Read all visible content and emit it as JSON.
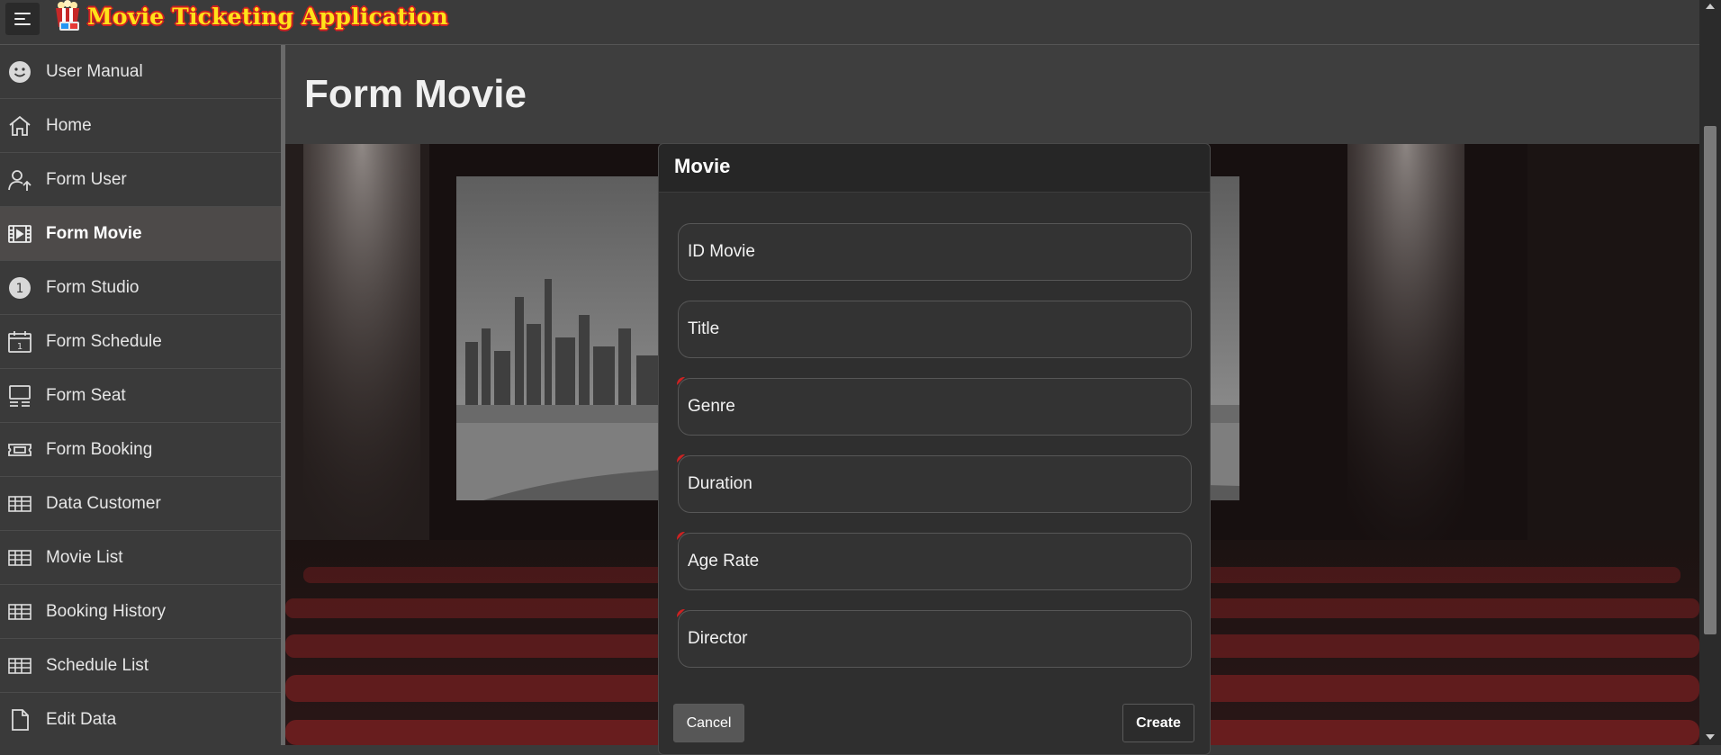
{
  "app": {
    "title": "Movie Ticketing Application"
  },
  "sidebar": {
    "items": [
      {
        "label": "User Manual",
        "icon": "smiley-icon",
        "active": false
      },
      {
        "label": "Home",
        "icon": "home-icon",
        "active": false
      },
      {
        "label": "Form User",
        "icon": "user-upload-icon",
        "active": false
      },
      {
        "label": "Form Movie",
        "icon": "film-icon",
        "active": true
      },
      {
        "label": "Form Studio",
        "icon": "number-one-icon",
        "active": false
      },
      {
        "label": "Form Schedule",
        "icon": "calendar-icon",
        "active": false
      },
      {
        "label": "Form Seat",
        "icon": "monitor-icon",
        "active": false
      },
      {
        "label": "Form Booking",
        "icon": "ticket-icon",
        "active": false
      },
      {
        "label": "Data Customer",
        "icon": "table-icon",
        "active": false
      },
      {
        "label": "Movie List",
        "icon": "table-icon",
        "active": false
      },
      {
        "label": "Booking History",
        "icon": "table-icon",
        "active": false
      },
      {
        "label": "Schedule List",
        "icon": "table-icon",
        "active": false
      },
      {
        "label": "Edit Data",
        "icon": "document-icon",
        "active": false
      }
    ]
  },
  "page": {
    "title": "Form Movie"
  },
  "modal": {
    "title": "Movie",
    "fields": [
      {
        "label": "ID Movie",
        "required": false
      },
      {
        "label": "Title",
        "required": false
      },
      {
        "label": "Genre",
        "required": true
      },
      {
        "label": "Duration",
        "required": true
      },
      {
        "label": "Age Rate",
        "required": true
      },
      {
        "label": "Director",
        "required": true
      }
    ],
    "cancel_label": "Cancel",
    "create_label": "Create"
  },
  "colors": {
    "title_yellow": "#ffe21a",
    "title_outline": "#d02020",
    "required_marker": "#cc2222",
    "seat_red": "#6b1d1f"
  }
}
